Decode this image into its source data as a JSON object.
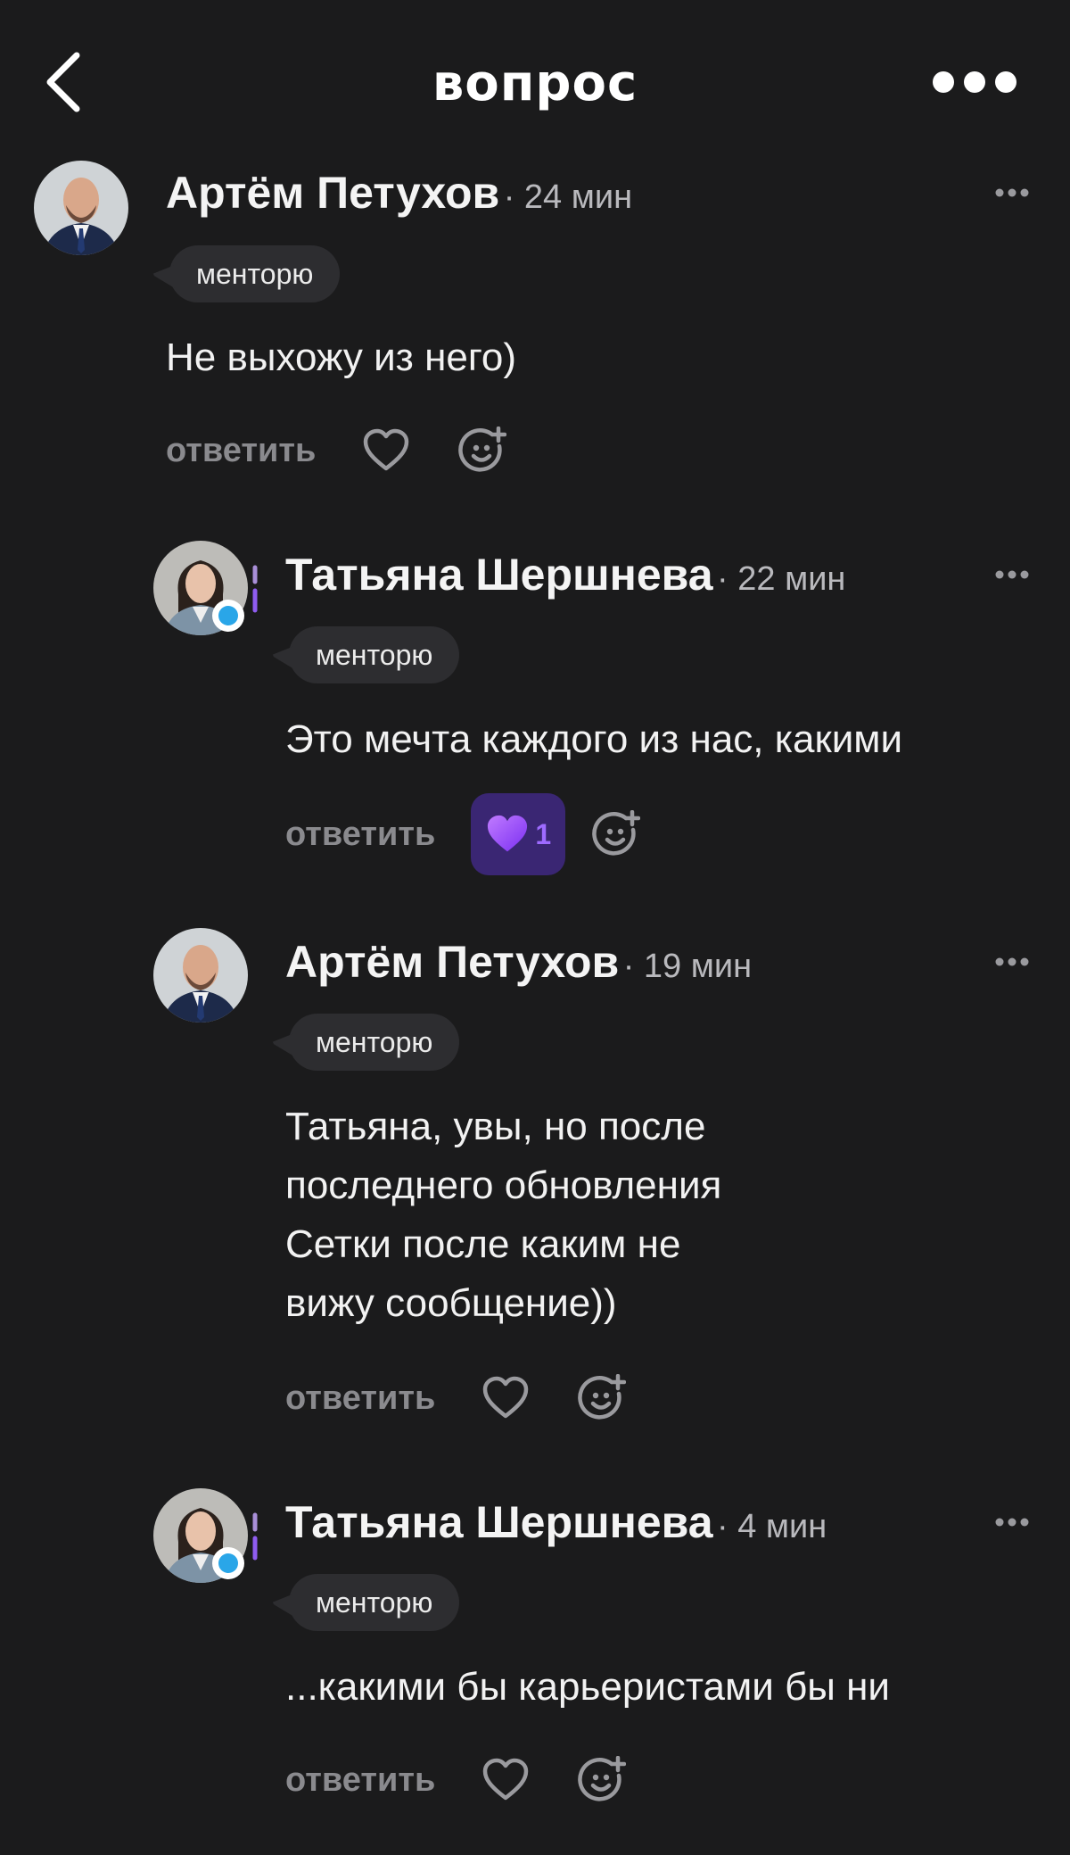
{
  "header": {
    "title": "вопрос",
    "back_icon": "chevron-left-icon",
    "more_icon": "more-horizontal-icon"
  },
  "comments": [
    {
      "author": "Артём Петухов",
      "time": "· 24 мин",
      "tag": "менторю",
      "text": "Не выхожу из него)",
      "reply_label": "ответить",
      "liked": false,
      "likes": ""
    },
    {
      "author": "Татьяна Шершнева",
      "time": "· 22 мин",
      "tag": "менторю",
      "text": "Это мечта каждого из нас, какими",
      "reply_label": "ответить",
      "liked": true,
      "likes": "1"
    },
    {
      "author": "Артём Петухов",
      "time": "· 19 мин",
      "tag": "менторю",
      "text": "Татьяна, увы, но после\nпоследнего обновления\nСетки после каким не\nвижу сообщение))",
      "reply_label": "ответить",
      "liked": false,
      "likes": ""
    },
    {
      "author": "Татьяна Шершнева",
      "time": "· 4 мин",
      "tag": "менторю",
      "text": "...какими бы карьеристами бы ни",
      "reply_label": "ответить",
      "liked": false,
      "likes": ""
    }
  ],
  "colors": {
    "background": "#1b1b1c",
    "tag_bg": "#2d2d30",
    "reply_text": "#8a8a8e",
    "like_active_bg": "#3a2673",
    "like_active_accent": "#9e6bff"
  }
}
